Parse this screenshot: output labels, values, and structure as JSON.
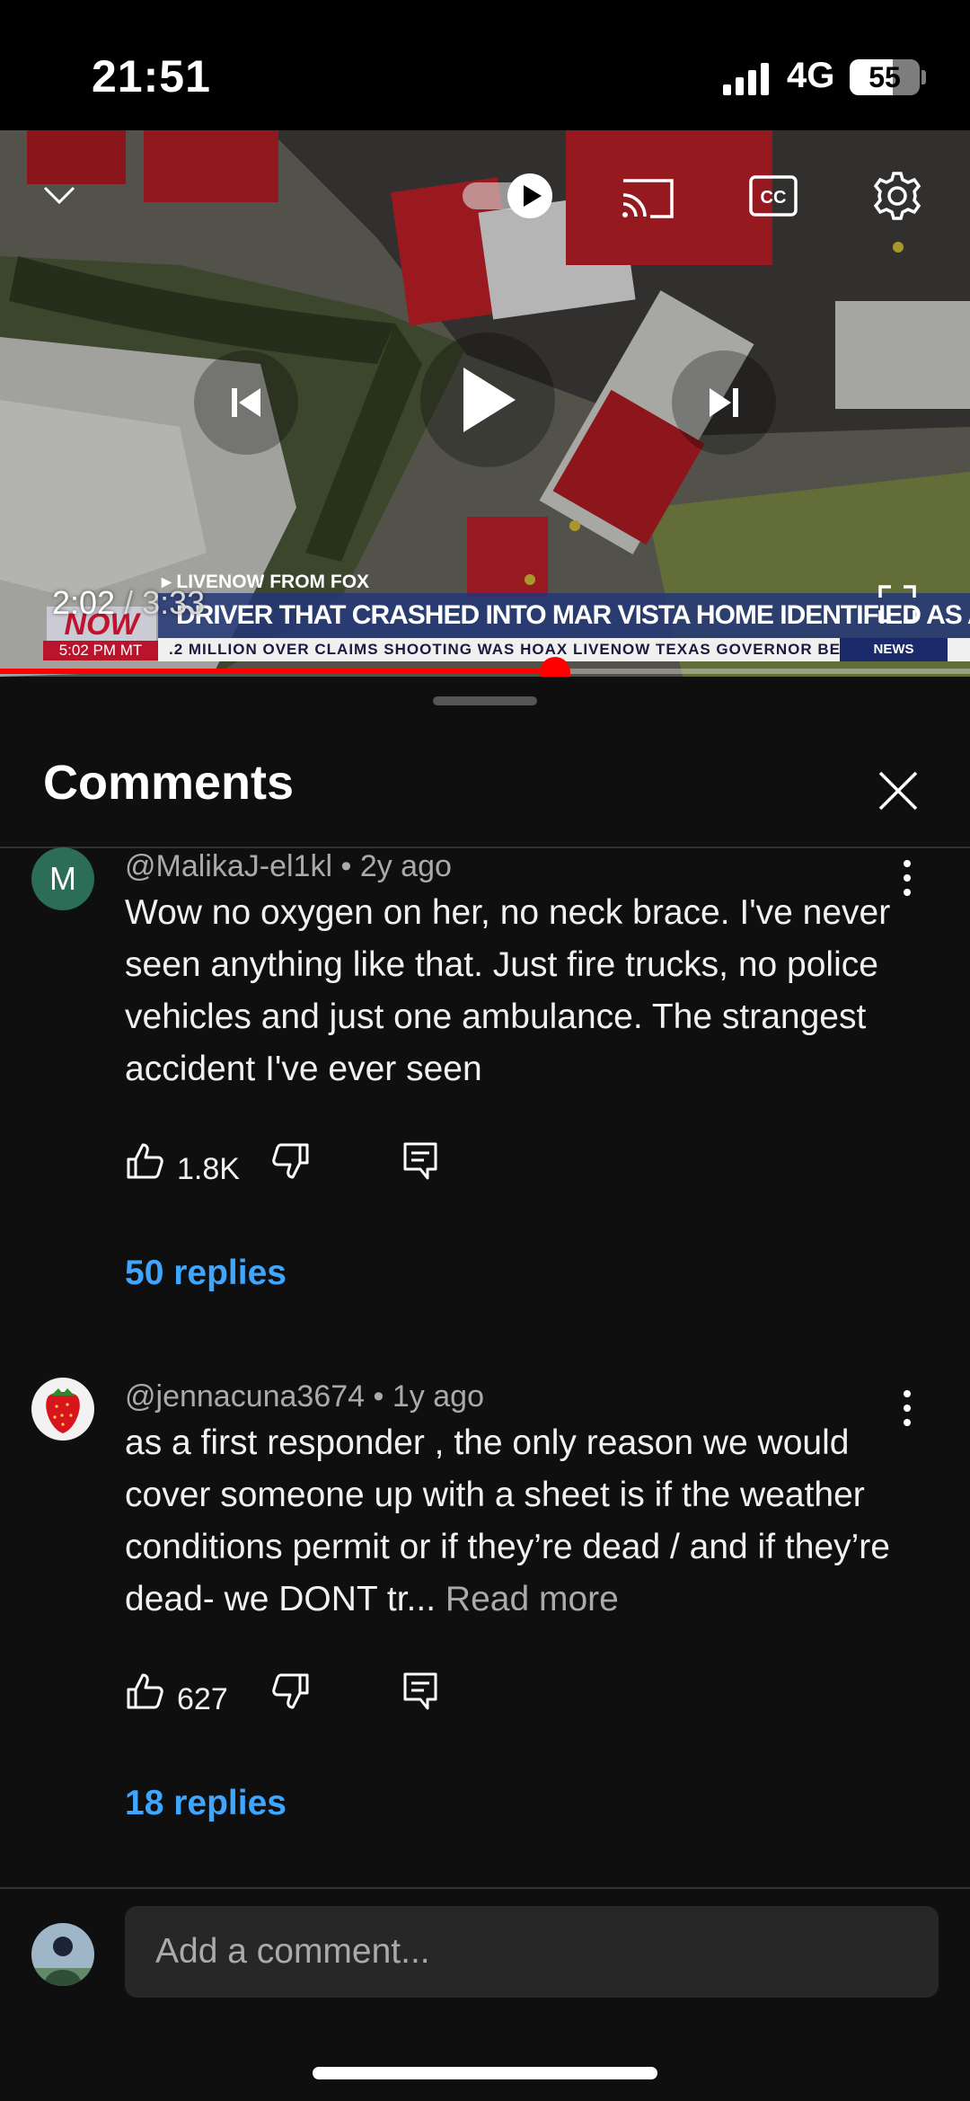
{
  "status_bar": {
    "time": "21:51",
    "network": "4G",
    "battery": "55"
  },
  "player": {
    "current_time": "2:02",
    "separator": " / ",
    "duration": "3:33",
    "progress_fraction": 0.572,
    "icons": [
      "chevron-down-icon",
      "autoplay-toggle-icon",
      "cast-icon",
      "captions-icon",
      "settings-icon",
      "previous-icon",
      "play-icon",
      "next-icon",
      "fullscreen-icon"
    ],
    "overlay": {
      "source_label": "▸ LIVENOW FROM FOX",
      "now_badge": "NOW",
      "clock": "5:02 PM MT",
      "headline": "DRIVER THAT CRASHED INTO MAR VISTA HOME IDENTIFIED AS ACTRESS ANNE HECHE",
      "subticker": ".2 MILLION OVER CLAIMS SHOOTING WAS HOAX   LIVENOW   TEXAS GOVERNOR BE",
      "news_badge": "NEWS"
    }
  },
  "comments_panel": {
    "title": "Comments",
    "comments": [
      {
        "avatar_letter": "M",
        "author": "@MalikaJ-el1kl",
        "time": "2y ago",
        "text": "Wow no oxygen on her, no neck brace. I've never seen anything like that. Just fire trucks, no police vehicles and just one ambulance. The strangest accident I've ever seen",
        "read_more": "",
        "likes": "1.8K",
        "replies": "50 replies"
      },
      {
        "avatar_letter": "",
        "author": "@jennacuna3674",
        "time": "1y ago",
        "text": "as a first responder , the only reason we would cover someone up with a sheet is if the weather conditions permit or if they’re dead / and if they’re dead- we DONT tr... ",
        "read_more": "Read more",
        "likes": "627",
        "replies": "18 replies"
      }
    ],
    "input_placeholder": "Add a comment..."
  },
  "colors": {
    "accent": "#ff0000",
    "link": "#3ea6ff",
    "background": "#0f0f0f"
  }
}
